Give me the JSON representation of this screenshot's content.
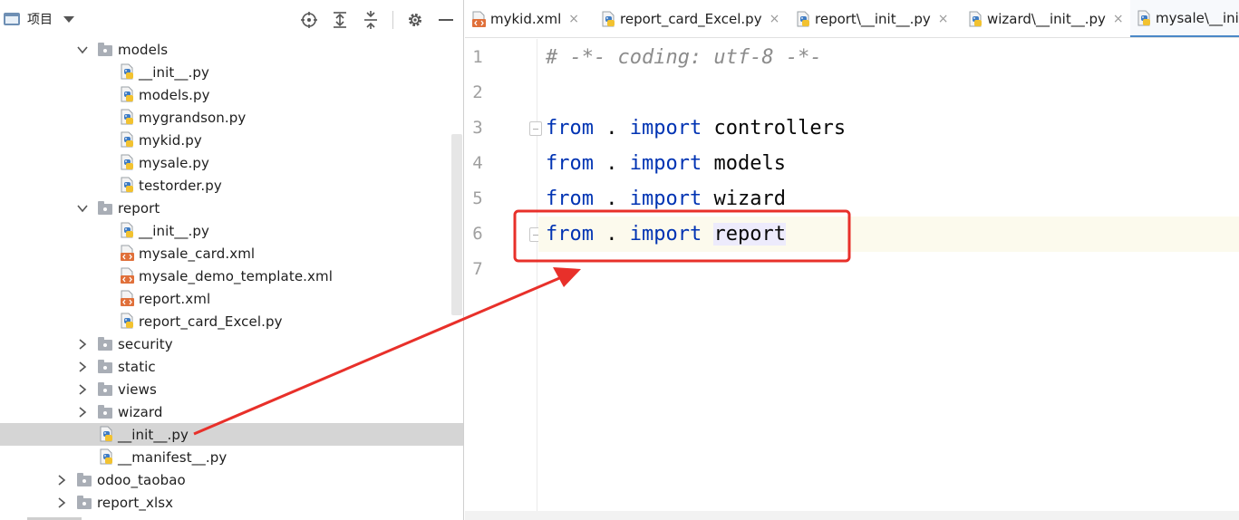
{
  "panel": {
    "title": "项目"
  },
  "tree": [
    {
      "label": "models",
      "type": "folder",
      "depth": 1,
      "expanded": true
    },
    {
      "label": "__init__.py",
      "type": "py",
      "depth": 2
    },
    {
      "label": "models.py",
      "type": "py",
      "depth": 2
    },
    {
      "label": "mygrandson.py",
      "type": "py",
      "depth": 2
    },
    {
      "label": "mykid.py",
      "type": "py",
      "depth": 2
    },
    {
      "label": "mysale.py",
      "type": "py",
      "depth": 2
    },
    {
      "label": "testorder.py",
      "type": "py",
      "depth": 2
    },
    {
      "label": "report",
      "type": "folder",
      "depth": 1,
      "expanded": true
    },
    {
      "label": "__init__.py",
      "type": "py",
      "depth": 2
    },
    {
      "label": "mysale_card.xml",
      "type": "xml",
      "depth": 2
    },
    {
      "label": "mysale_demo_template.xml",
      "type": "xml",
      "depth": 2
    },
    {
      "label": "report.xml",
      "type": "xml",
      "depth": 2
    },
    {
      "label": "report_card_Excel.py",
      "type": "py",
      "depth": 2
    },
    {
      "label": "security",
      "type": "folder",
      "depth": 1,
      "expanded": false
    },
    {
      "label": "static",
      "type": "folder",
      "depth": 1,
      "expanded": false
    },
    {
      "label": "views",
      "type": "folder",
      "depth": 1,
      "expanded": false
    },
    {
      "label": "wizard",
      "type": "folder",
      "depth": 1,
      "expanded": false
    },
    {
      "label": "__init__.py",
      "type": "py",
      "depth": 1,
      "selected": true
    },
    {
      "label": "__manifest__.py",
      "type": "py",
      "depth": 1
    },
    {
      "label": "odoo_taobao",
      "type": "folder",
      "depth": 0,
      "expanded": false
    },
    {
      "label": "report_xlsx",
      "type": "folder",
      "depth": 0,
      "expanded": false
    }
  ],
  "tabs": [
    {
      "label": "mykid.xml",
      "type": "xml",
      "active": false
    },
    {
      "label": "report_card_Excel.py",
      "type": "py",
      "active": false
    },
    {
      "label": "report\\__init__.py",
      "type": "py",
      "active": false
    },
    {
      "label": "wizard\\__init__.py",
      "type": "py",
      "active": false
    },
    {
      "label": "mysale\\__init__.py",
      "type": "py",
      "active": true
    }
  ],
  "tab_close_glyph": "×",
  "editor": {
    "line_numbers": [
      "1",
      "2",
      "3",
      "4",
      "5",
      "6",
      "7"
    ],
    "current_line": 6,
    "lines": [
      [
        {
          "t": "# -*- coding: utf-8 -*-",
          "c": "cmt"
        }
      ],
      [],
      [
        {
          "t": "from",
          "c": "kw"
        },
        {
          "t": " . ",
          "c": "tx"
        },
        {
          "t": "import",
          "c": "kw"
        },
        {
          "t": " controllers",
          "c": "tx"
        }
      ],
      [
        {
          "t": "from",
          "c": "kw"
        },
        {
          "t": " . ",
          "c": "tx"
        },
        {
          "t": "import",
          "c": "kw"
        },
        {
          "t": " models",
          "c": "tx"
        }
      ],
      [
        {
          "t": "from",
          "c": "kw"
        },
        {
          "t": " . ",
          "c": "tx"
        },
        {
          "t": "import",
          "c": "kw"
        },
        {
          "t": " wizard",
          "c": "tx"
        }
      ],
      [
        {
          "t": "from",
          "c": "kw"
        },
        {
          "t": " . ",
          "c": "tx"
        },
        {
          "t": "import",
          "c": "kw"
        },
        {
          "t": " ",
          "c": "tx"
        },
        {
          "t": "report",
          "c": "tx hl"
        }
      ],
      []
    ]
  },
  "colors": {
    "keyword": "#0033b3",
    "comment": "#8c8c8c",
    "annotation": "#e8302a",
    "selection_row": "#d5d5d5",
    "current_line": "#fcfaed"
  }
}
